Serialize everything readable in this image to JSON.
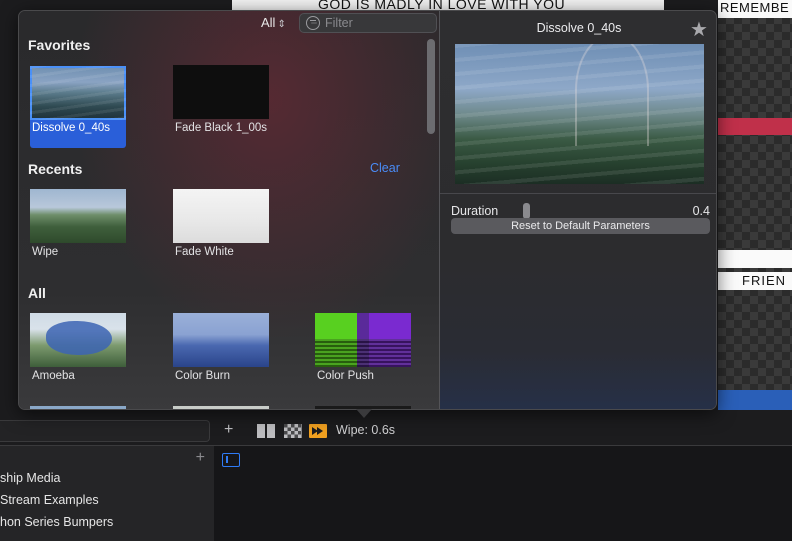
{
  "background": {
    "viewer_text": "GOD IS MADLY IN LOVE WITH YOU",
    "right_clip_top_text": "REMEMBE",
    "right_clip_mid_text": "FRIEN"
  },
  "browser": {
    "scope_label": "All",
    "filter_placeholder": "Filter",
    "favorites": {
      "heading": "Favorites",
      "items": [
        {
          "label": "Dissolve 0_40s"
        },
        {
          "label": "Fade Black 1_00s"
        }
      ]
    },
    "recents": {
      "heading": "Recents",
      "clear_label": "Clear",
      "items": [
        {
          "label": "Wipe"
        },
        {
          "label": "Fade White"
        }
      ]
    },
    "all": {
      "heading": "All",
      "items": [
        {
          "label": "Amoeba"
        },
        {
          "label": "Color Burn"
        },
        {
          "label": "Color Push"
        }
      ]
    }
  },
  "inspector": {
    "title": "Dissolve 0_40s",
    "duration_label": "Duration",
    "duration_value": "0.4",
    "duration_level": 0.02,
    "reset_label": "Reset to Default Parameters"
  },
  "timeline": {
    "status": "Wipe: 0.6s"
  },
  "library": {
    "items": [
      {
        "label": "ship Media"
      },
      {
        "label": "Stream Examples"
      },
      {
        "label": "hon Series Bumpers"
      }
    ]
  },
  "colors": {
    "accent": "#2a5fd9",
    "link": "#4a8cf7",
    "transition_icon": "#f0a020"
  }
}
